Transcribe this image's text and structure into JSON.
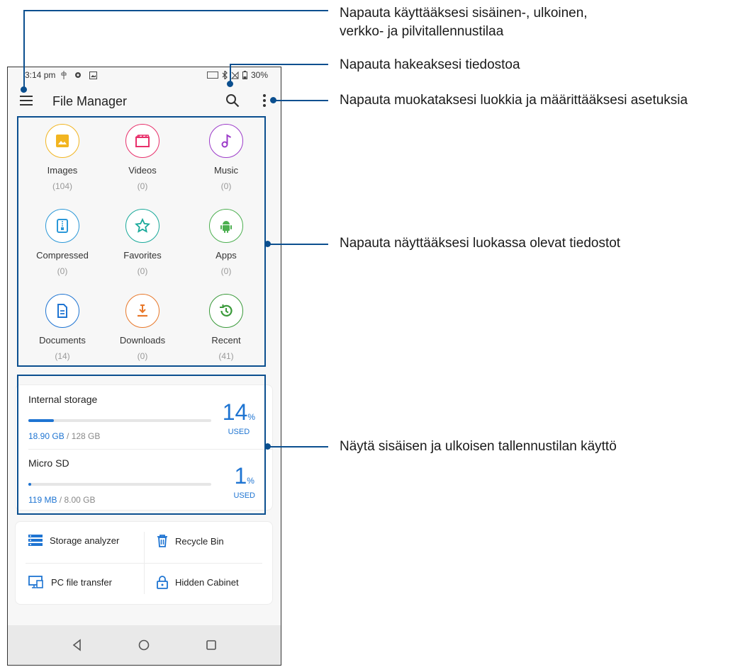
{
  "status_bar": {
    "time": "3:14 pm",
    "battery": "30%"
  },
  "app_bar": {
    "title": "File Manager"
  },
  "categories": [
    {
      "label": "Images",
      "count": "(104)",
      "icon": "image-icon",
      "color": "#f2b521"
    },
    {
      "label": "Videos",
      "count": "(0)",
      "icon": "video-icon",
      "color": "#e8306b"
    },
    {
      "label": "Music",
      "count": "(0)",
      "icon": "music-icon",
      "color": "#9c3bc9"
    },
    {
      "label": "Compressed",
      "count": "(0)",
      "icon": "zip-icon",
      "color": "#2b98d8"
    },
    {
      "label": "Favorites",
      "count": "(0)",
      "icon": "star-icon",
      "color": "#18a99a"
    },
    {
      "label": "Apps",
      "count": "(0)",
      "icon": "android-icon",
      "color": "#4caf50"
    },
    {
      "label": "Documents",
      "count": "(14)",
      "icon": "document-icon",
      "color": "#1e74d2"
    },
    {
      "label": "Downloads",
      "count": "(0)",
      "icon": "download-icon",
      "color": "#e8782a"
    },
    {
      "label": "Recent",
      "count": "(41)",
      "icon": "history-icon",
      "color": "#3a9a3a"
    }
  ],
  "storage": {
    "internal": {
      "name": "Internal storage",
      "used": "18.90 GB",
      "total": " / 128 GB",
      "percent": "14",
      "percent_symbol": "%",
      "used_label": "USED",
      "fill": 0.14
    },
    "sd": {
      "name": "Micro SD",
      "used": "119 MB",
      "total": " / 8.00 GB",
      "percent": "1",
      "percent_symbol": "%",
      "used_label": "USED",
      "fill": 0.015
    }
  },
  "tools": {
    "storage_analyzer": "Storage analyzer",
    "recycle_bin": "Recycle Bin",
    "pc_transfer": "PC file transfer",
    "hidden_cabinet": "Hidden Cabinet"
  },
  "callouts": {
    "menu_line1": "Napauta käyttääksesi sisäinen-, ulkoinen,",
    "menu_line2": "verkko- ja pilvitallennustilaa",
    "search": "Napauta hakeaksesi tiedostoa",
    "more": "Napauta muokataksesi luokkia ja määrittääksesi asetuksia",
    "categories": "Napauta näyttääksesi luokassa olevat tiedostot",
    "storage": "Näytä sisäisen ja ulkoisen tallennustilan käyttö"
  },
  "colors": {
    "accent": "#1e74d2",
    "callout_line": "#0b4f8f"
  }
}
